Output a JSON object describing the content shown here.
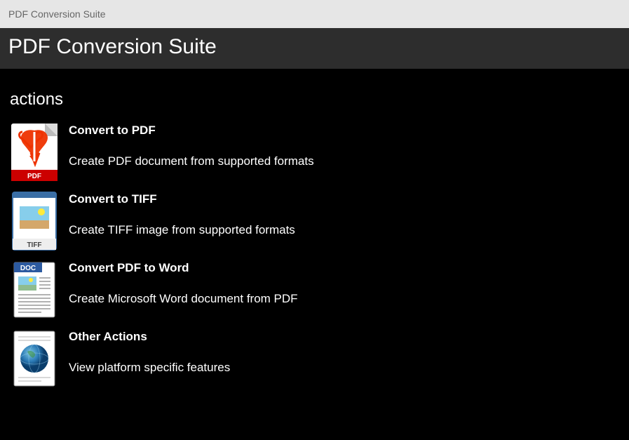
{
  "window": {
    "title": "PDF Conversion Suite"
  },
  "header": {
    "title": "PDF Conversion Suite"
  },
  "section": {
    "heading": "actions"
  },
  "actions": [
    {
      "title": "Convert to PDF",
      "description": "Create PDF document from supported formats"
    },
    {
      "title": "Convert to TIFF",
      "description": "Create TIFF image from supported formats"
    },
    {
      "title": "Convert PDF to Word",
      "description": "Create Microsoft Word document from PDF"
    },
    {
      "title": "Other Actions",
      "description": "View platform specific features"
    }
  ]
}
